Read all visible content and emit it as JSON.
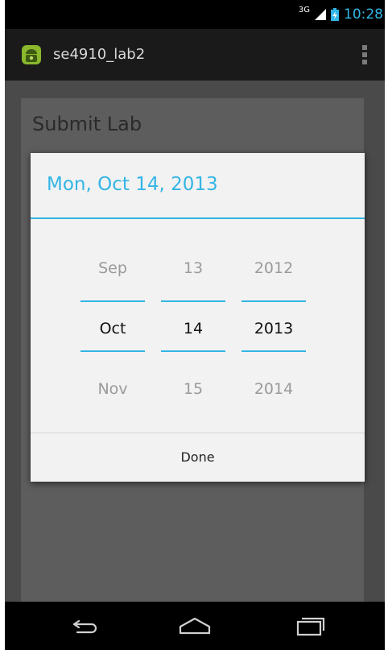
{
  "status_bar": {
    "network_type": "3G",
    "time": "10:28",
    "icons": [
      "signal-icon",
      "battery-icon"
    ]
  },
  "action_bar": {
    "app_title": "se4910_lab2",
    "icons": [
      "android-app-icon",
      "overflow-menu-icon"
    ]
  },
  "screen": {
    "title": "Submit Lab"
  },
  "date_dialog": {
    "title": "Mon, Oct 14, 2013",
    "month": {
      "prev": "Sep",
      "current": "Oct",
      "next": "Nov"
    },
    "day": {
      "prev": "13",
      "current": "14",
      "next": "15"
    },
    "year": {
      "prev": "2012",
      "current": "2013",
      "next": "2014"
    },
    "done_label": "Done"
  },
  "nav_bar": {
    "icons": [
      "back-icon",
      "home-icon",
      "recent-apps-icon"
    ]
  },
  "colors": {
    "accent": "#33b5e5",
    "dialog_bg": "#f2f2f2",
    "action_bar_bg": "#1a1a1a"
  }
}
